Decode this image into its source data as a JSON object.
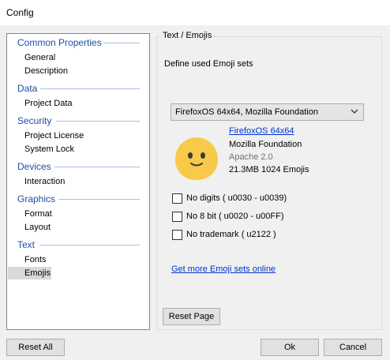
{
  "window": {
    "title": "Config"
  },
  "nav": {
    "groups": [
      {
        "header": "Common Properties",
        "items": [
          "General",
          "Description"
        ]
      },
      {
        "header": "Data",
        "items": [
          "Project Data"
        ]
      },
      {
        "header": "Security",
        "items": [
          "Project License",
          "System Lock"
        ]
      },
      {
        "header": "Devices",
        "items": [
          "Interaction"
        ]
      },
      {
        "header": "Graphics",
        "items": [
          "Format",
          "Layout"
        ]
      },
      {
        "header": "Text",
        "items": [
          "Fonts",
          "Emojis"
        ]
      }
    ],
    "selected": "Emojis"
  },
  "panel": {
    "group_title": "Text / Emojis",
    "define_label": "Define used Emoji sets",
    "emoji_set_selected": "FirefoxOS 64x64, Mozilla Foundation",
    "set_info": {
      "name": "FirefoxOS 64x64",
      "vendor": "Mozilla Foundation",
      "license": "Apache 2.0",
      "size_count": "21.3MB 1024 Emojis"
    },
    "options": [
      {
        "label": "No digits ( u0030 - u0039)",
        "checked": false
      },
      {
        "label": "No 8 bit ( u0020 - u00FF)",
        "checked": false
      },
      {
        "label": "No trademark ( u2122 )",
        "checked": false
      }
    ],
    "more_link": "Get more Emoji sets online",
    "reset_page": "Reset Page"
  },
  "footer": {
    "reset_all": "Reset All",
    "ok": "Ok",
    "cancel": "Cancel"
  },
  "colors": {
    "group_header": "#1e4fa3",
    "link": "#0033cc",
    "emoji_face": "#f9c94a",
    "selected_bg": "#d9d9d9"
  },
  "icons": {
    "dropdown": "chevron-down-icon",
    "preview": "smiley-emoji-icon"
  }
}
